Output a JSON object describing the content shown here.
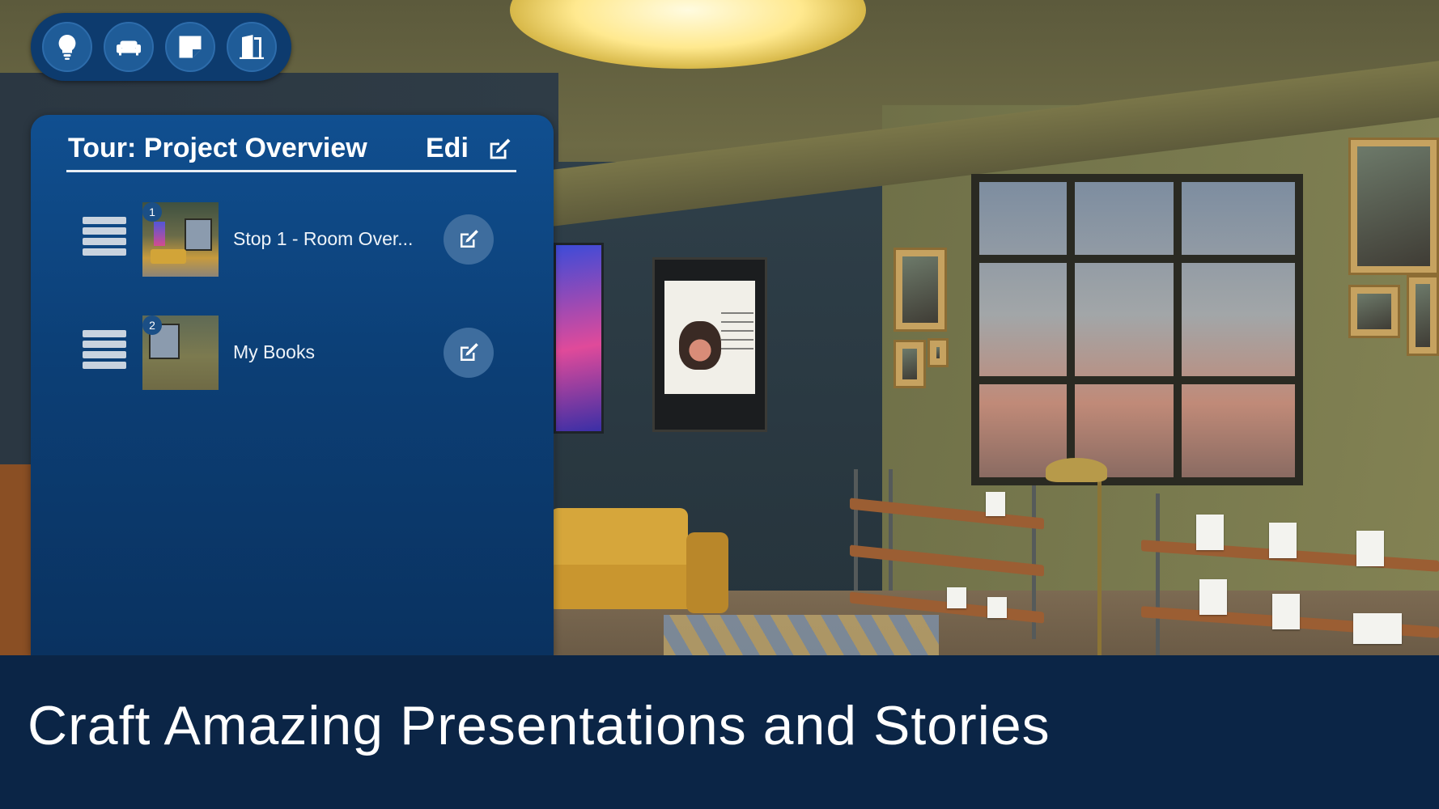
{
  "toolbar": {
    "buttons": [
      {
        "icon": "lightbulb-icon"
      },
      {
        "icon": "sofa-icon"
      },
      {
        "icon": "sticky-note-icon"
      },
      {
        "icon": "door-icon"
      }
    ]
  },
  "tour_panel": {
    "title": "Tour: Project Overview",
    "edit_label": "Edi",
    "edit_icon": "edit-icon",
    "stops": [
      {
        "number": "1",
        "label": "Stop 1 - Room Over..."
      },
      {
        "number": "2",
        "label": "My Books"
      }
    ]
  },
  "caption": {
    "text": "Craft Amazing Presentations and Stories"
  },
  "colors": {
    "panel_blue": "#0c3f76",
    "caption_bg": "#0b2546",
    "toolbar_bg": "#0d3b6e"
  }
}
